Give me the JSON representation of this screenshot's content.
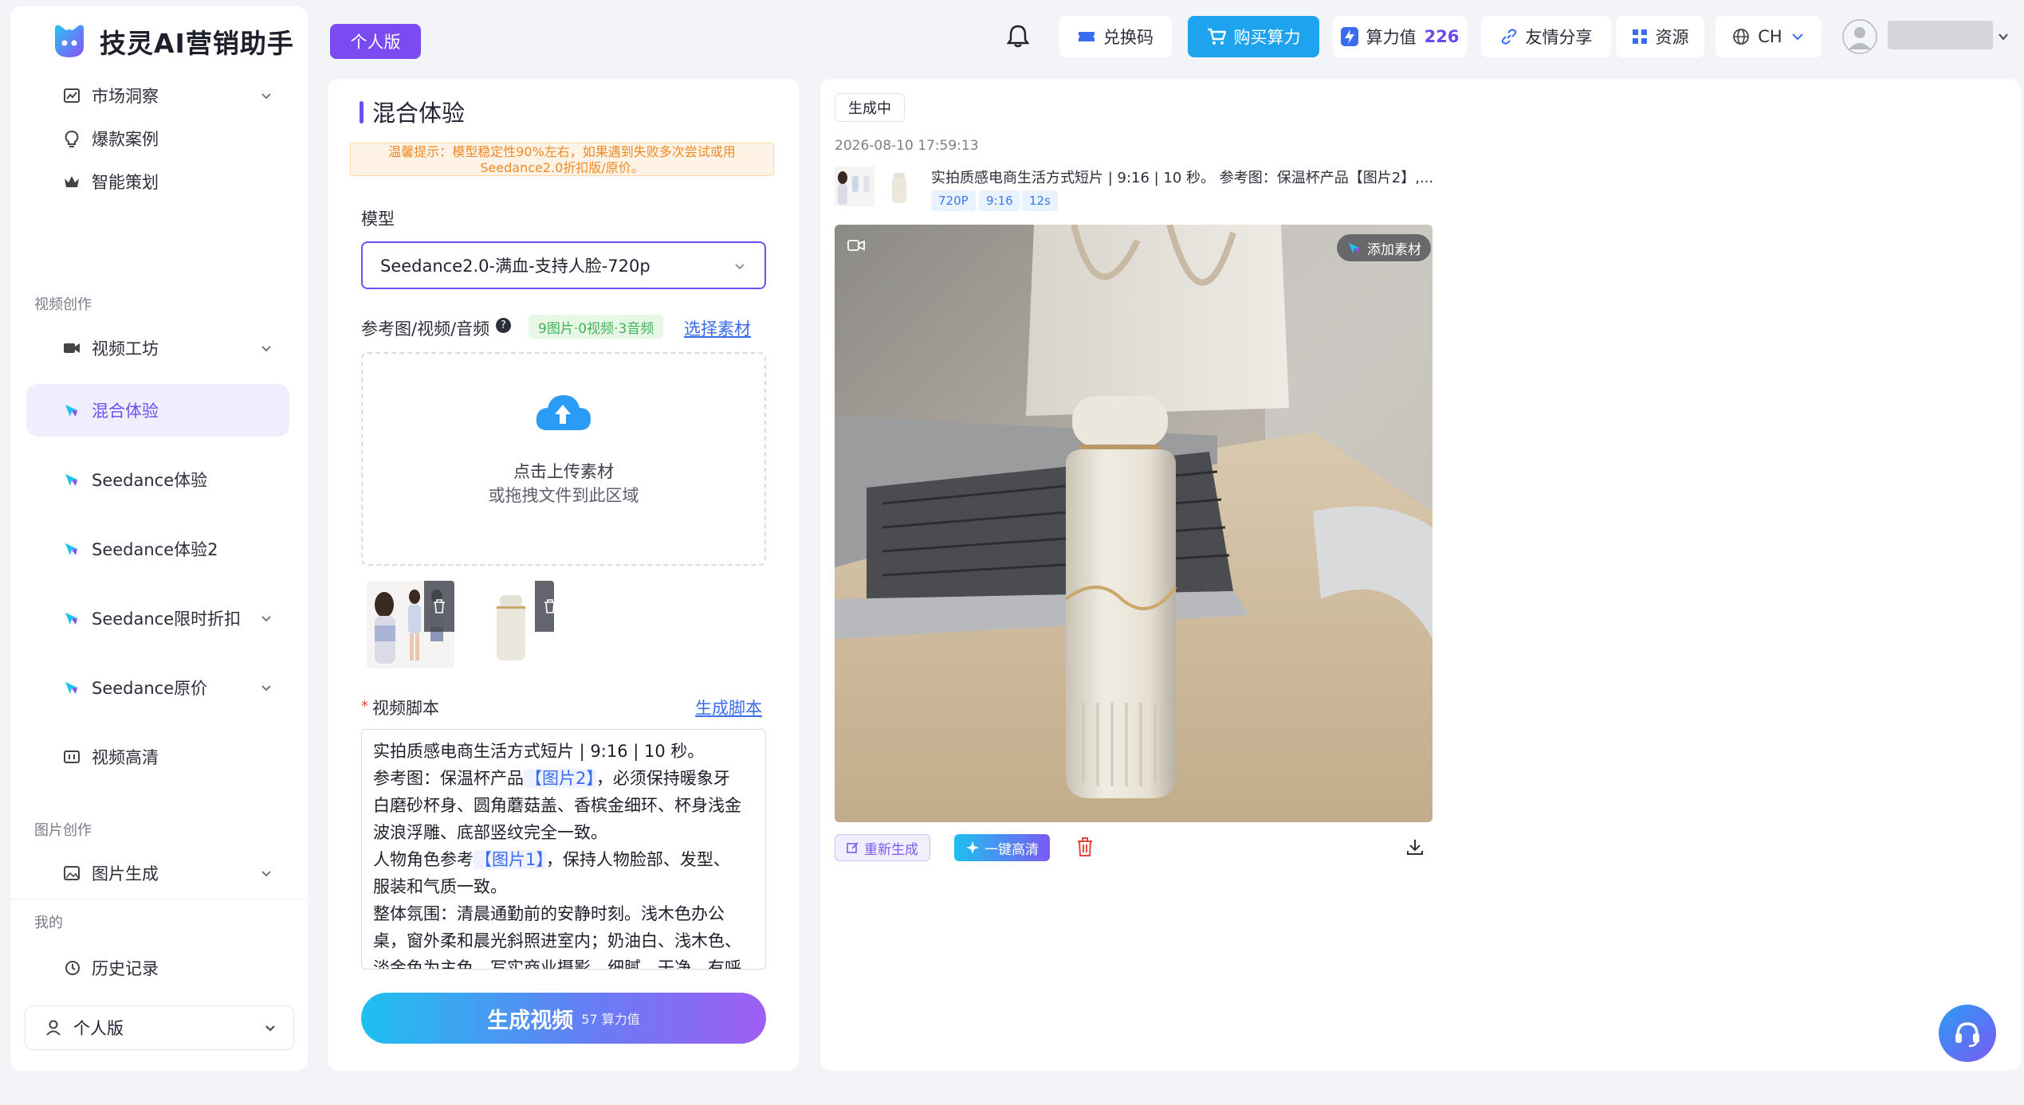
{
  "app": {
    "logo_text": "技灵AI营销助手",
    "edition_badge": "个人版"
  },
  "sidebar": {
    "items": [
      {
        "label": "市场洞察",
        "icon": "chart-icon",
        "has_chevron": true
      },
      {
        "label": "爆款案例",
        "icon": "bulb-icon",
        "has_chevron": false
      },
      {
        "label": "智能策划",
        "icon": "crown-icon",
        "has_chevron": false
      }
    ],
    "group_video": "视频创作",
    "video_items": [
      {
        "label": "视频工坊",
        "icon": "video-camera-icon",
        "has_chevron": true
      },
      {
        "label": "混合体验",
        "icon": "magic-wand-icon",
        "has_chevron": false,
        "active": true
      },
      {
        "label": "Seedance体验",
        "icon": "magic-wand-icon",
        "has_chevron": false
      },
      {
        "label": "Seedance体验2",
        "icon": "magic-wand-icon",
        "has_chevron": false
      },
      {
        "label": "Seedance限时折扣",
        "icon": "magic-wand-icon",
        "has_chevron": true
      },
      {
        "label": "Seedance原价",
        "icon": "magic-wand-icon",
        "has_chevron": true
      },
      {
        "label": "视频高清",
        "icon": "enhance-icon",
        "has_chevron": false
      }
    ],
    "group_image": "图片创作",
    "image_items": [
      {
        "label": "图片生成",
        "icon": "image-icon",
        "has_chevron": true
      }
    ],
    "group_mine": "我的",
    "mine_items": [
      {
        "label": "历史记录",
        "icon": "history-icon"
      }
    ],
    "footer_label": "个人版"
  },
  "topbar": {
    "redeem": "兑换码",
    "buy_power": "购买算力",
    "power_label": "算力值",
    "power_value": "226",
    "share": "友情分享",
    "resources": "资源",
    "language": "CH"
  },
  "composer": {
    "title": "混合体验",
    "tip": "温馨提示：模型稳定性90%左右，如果遇到失败多次尝试或用Seedance2.0折扣版/原价。",
    "model_label": "模型",
    "model_value": "Seedance2.0-满血-支持人脸-720p",
    "reference_label": "参考图/视频/音频",
    "reference_count": "9图片·0视频·3音频",
    "select_material": "选择素材",
    "upload_line1": "点击上传素材",
    "upload_line2": "或拖拽文件到此区域",
    "script_label": "视频脚本",
    "generate_script": "生成脚本",
    "script_lines": {
      "l1": "实拍质感电商生活方式短片 | 9:16 | 10 秒。",
      "l2a": "参考图：保温杯产品",
      "l2m": "【图片2】",
      "l2b": "，必须保持暖象牙",
      "l3": "白磨砂杯身、圆角蘑菇盖、香槟金细环、杯身浅金",
      "l4": "波浪浮雕、底部竖纹完全一致。",
      "l5a": "人物角色参考",
      "l5m": "【图片1】",
      "l5b": "，保持人物脸部、发型、",
      "l6": "服装和气质一致。",
      "l7": "整体氛围：清晨通勤前的安静时刻。浅木色办公",
      "l8": "桌，窗外柔和晨光斜照进室内；奶油白、浅木色、",
      "l9": "淡金色为主色，写实商业摄影，细腻，干净，有呼"
    },
    "generate_button": "生成视频",
    "generate_cost": "57 算力值"
  },
  "result": {
    "status": "生成中",
    "timestamp": "2026-08-10 17:59:13",
    "description": "实拍质感电商生活方式短片 | 9:16 | 10 秒。 参考图：保温杯产品【图片2】,...",
    "tags": [
      "720P",
      "9:16",
      "12s"
    ],
    "add_material": "添加素材",
    "regenerate": "重新生成",
    "one_click_hd": "一键高清"
  }
}
